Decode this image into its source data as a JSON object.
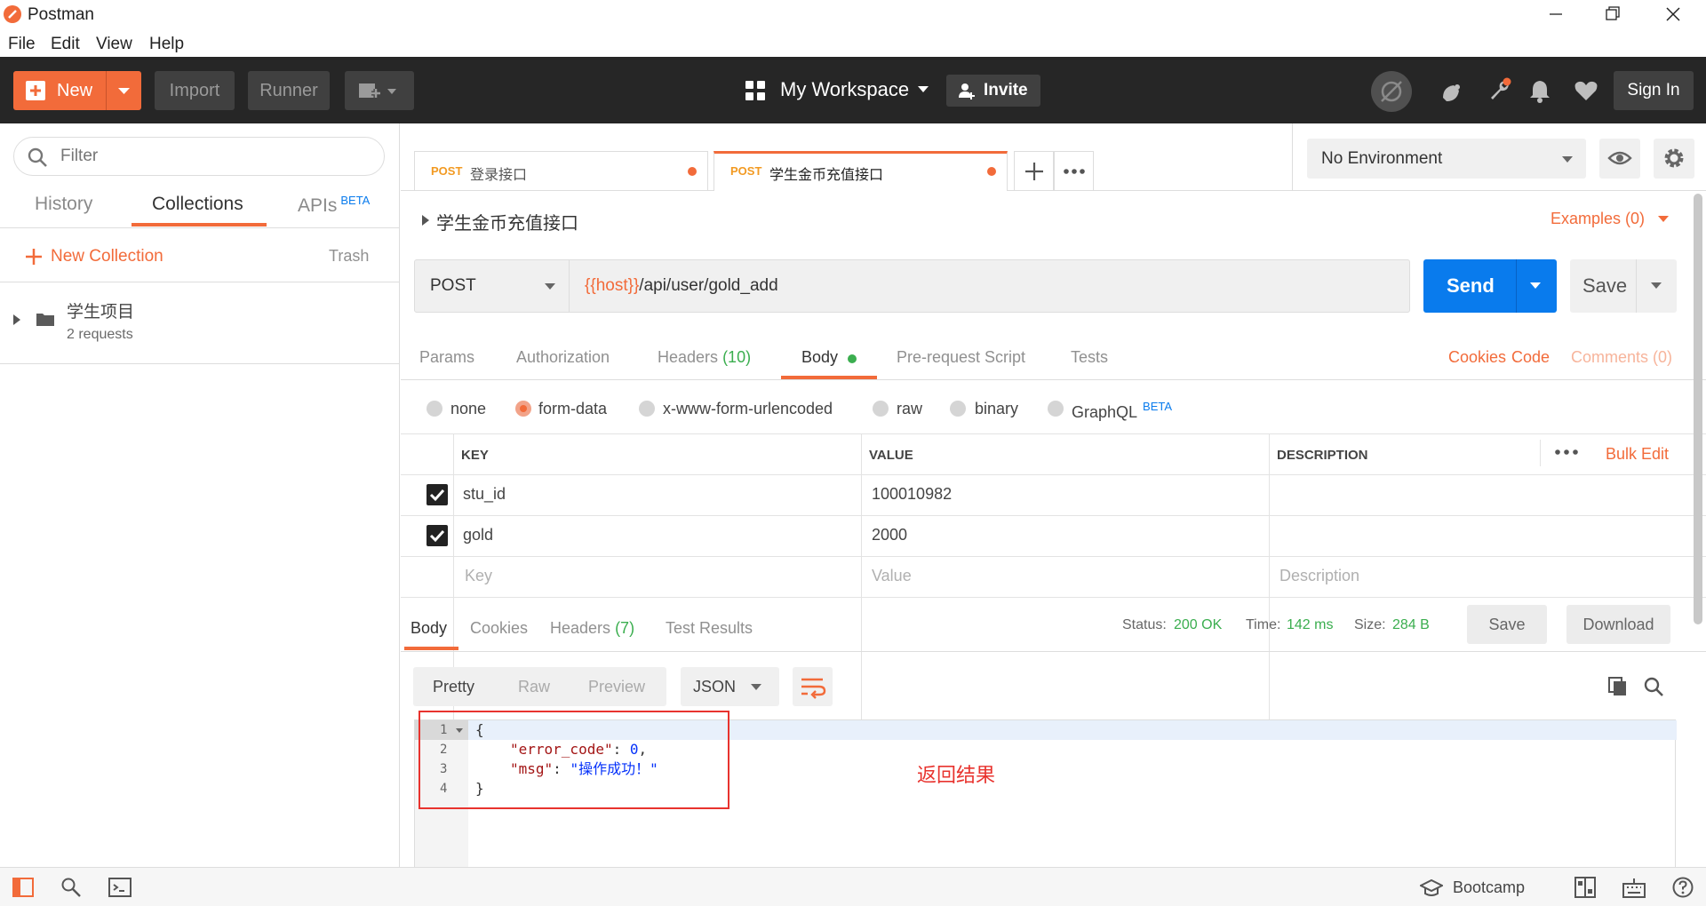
{
  "window": {
    "title": "Postman"
  },
  "menu": [
    "File",
    "Edit",
    "View",
    "Help"
  ],
  "toolbar": {
    "new_label": "New",
    "import_label": "Import",
    "runner_label": "Runner",
    "workspace_label": "My Workspace",
    "invite_label": "Invite",
    "signin_label": "Sign In"
  },
  "sidebar": {
    "filter_placeholder": "Filter",
    "tabs": {
      "history": "History",
      "collections": "Collections",
      "apis": "APIs",
      "apis_badge": "BETA"
    },
    "new_collection": "New Collection",
    "trash": "Trash",
    "collections": [
      {
        "name": "学生项目",
        "meta": "2 requests"
      }
    ]
  },
  "request_tabs": [
    {
      "method": "POST",
      "name": "登录接口"
    },
    {
      "method": "POST",
      "name": "学生金币充值接口"
    }
  ],
  "environment": {
    "selected": "No Environment"
  },
  "request": {
    "name": "学生金币充值接口",
    "examples": "Examples (0)",
    "method": "POST",
    "url_var": "{{host}}",
    "url_path": "/api/user/gold_add",
    "send_label": "Send",
    "save_label": "Save"
  },
  "request_subtabs": {
    "params": "Params",
    "authorization": "Authorization",
    "headers": "Headers",
    "headers_count": "(10)",
    "body": "Body",
    "prerequest": "Pre-request Script",
    "tests": "Tests",
    "cookies": "Cookies",
    "code": "Code",
    "comments": "Comments (0)"
  },
  "body_types": {
    "none": "none",
    "form_data": "form-data",
    "urlencoded": "x-www-form-urlencoded",
    "raw": "raw",
    "binary": "binary",
    "graphql": "GraphQL",
    "graphql_badge": "BETA",
    "selected": "form-data"
  },
  "form_table": {
    "headers": {
      "key": "KEY",
      "value": "VALUE",
      "description": "DESCRIPTION",
      "bulk_edit": "Bulk Edit"
    },
    "rows": [
      {
        "checked": true,
        "key": "stu_id",
        "value": "100010982",
        "description": ""
      },
      {
        "checked": true,
        "key": "gold",
        "value": "2000",
        "description": ""
      }
    ],
    "placeholders": {
      "key": "Key",
      "value": "Value",
      "description": "Description"
    }
  },
  "response": {
    "tabs": {
      "body": "Body",
      "cookies": "Cookies",
      "headers": "Headers",
      "headers_count": "(7)",
      "test_results": "Test Results"
    },
    "status_label": "Status:",
    "status_value": "200 OK",
    "time_label": "Time:",
    "time_value": "142 ms",
    "size_label": "Size:",
    "size_value": "284 B",
    "save_label": "Save",
    "download_label": "Download",
    "view_modes": {
      "pretty": "Pretty",
      "raw": "Raw",
      "preview": "Preview"
    },
    "format": "JSON",
    "code_lines": [
      {
        "n": "1",
        "text": "{"
      },
      {
        "n": "2",
        "key": "\"error_code\"",
        "sep": ": ",
        "val": "0",
        "end": ","
      },
      {
        "n": "3",
        "key": "\"msg\"",
        "sep": ": ",
        "val": "\"操作成功！\"",
        "end": ""
      },
      {
        "n": "4",
        "text": "}"
      }
    ],
    "annotation": "返回结果"
  },
  "statusbar": {
    "bootcamp": "Bootcamp"
  },
  "colors": {
    "accent": "#f26b3a",
    "send": "#097bed",
    "dark_bar": "#262626",
    "annotation": "#e8332e"
  }
}
